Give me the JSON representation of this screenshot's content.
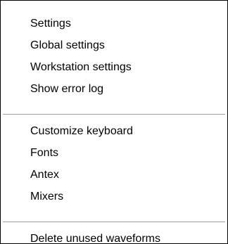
{
  "context_menu": {
    "groups": [
      {
        "items": [
          {
            "label": "Settings"
          },
          {
            "label": "Global settings"
          },
          {
            "label": "Workstation settings"
          },
          {
            "label": "Show error log"
          }
        ]
      },
      {
        "items": [
          {
            "label": "Customize keyboard"
          },
          {
            "label": "Fonts"
          },
          {
            "label": "Antex"
          },
          {
            "label": "Mixers"
          }
        ]
      },
      {
        "items": [
          {
            "label": "Delete unused waveforms"
          }
        ]
      }
    ]
  }
}
